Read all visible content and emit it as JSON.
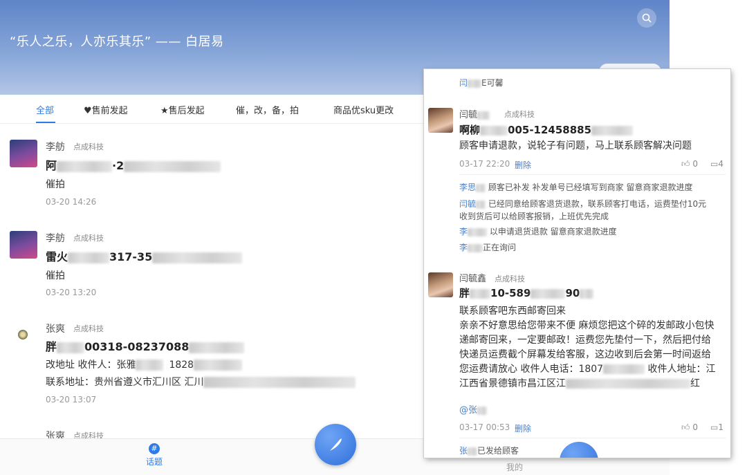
{
  "banner": {
    "quote": "“乐人之乐，人亦乐其乐” —— 白居易"
  },
  "tabs": [
    "全部",
    "♥售前发起",
    "★售后发起",
    "催，改，备，拍",
    "商品优sku更改"
  ],
  "posts": [
    {
      "user": "李舫",
      "corp": "点成科技",
      "title_pre": "阿",
      "title_mid": "·2",
      "body": [
        "催拍"
      ],
      "time": "03-20 14:26"
    },
    {
      "user": "李舫",
      "corp": "点成科技",
      "title_pre": "雷火",
      "title_mid": "317-35",
      "body": [
        "催拍"
      ],
      "time": "03-20 13:20"
    },
    {
      "user": "张爽",
      "corp": "点成科技",
      "title_pre": "胖",
      "title_mid": "00318-08237088",
      "body": [
        "改地址  收件人：张雅",
        "联系地址：贵州省遵义市汇川区 汇川"
      ],
      "body_extra": "1828",
      "time": "03-20 13:07"
    },
    {
      "user": "张爽",
      "corp": "点成科技"
    }
  ],
  "bottom_nav": {
    "topic_icon": "#",
    "topic_label": "话题",
    "mine_label": "我的"
  },
  "popup": {
    "top_line": {
      "name": "闫",
      "text": "E可馨"
    },
    "thread1": {
      "user": "闫毓",
      "corp": "点成科技",
      "title_pre": "啊柳",
      "title_mid": "005-12458885",
      "body": "顾客申请退款，说轮子有问题，马上联系顾客解决问题",
      "time": "03-17 22:20",
      "delete": "删除",
      "likes": "0",
      "comments": "4",
      "replies": [
        {
          "name": "李思",
          "text": "顾客已补发 补发单号已经填写到商家 留意商家退款进度"
        },
        {
          "name": "闫毓",
          "text": "已经同意给顾客退货退款，联系顾客打电话，运费垫付10元"
        },
        {
          "name": "",
          "text": "收到货后可以给顾客报销，上班优先完成"
        },
        {
          "name": "李",
          "text": "以申请退货退款 留意商家退款进度"
        },
        {
          "name": "李",
          "text": "正在询问"
        }
      ]
    },
    "thread2": {
      "user": "闫毓鑫",
      "corp": "点成科技",
      "title_pre": "胖",
      "title_mid": "10-589",
      "title_end": "90",
      "body_lines": [
        "联系顾客吧东西邮寄回来",
        "亲亲不好意思给您带来不便 麻烦您把这个碎的发邮政小包快",
        "递邮寄回来，一定要邮政！运费您先垫付一下，然后把付给",
        "快递员运费截个屏幕发给客服，这边收到后会第一时间返给",
        "您运费请放心 收件人电话：1807",
        "江西省景德镇市昌江区江"
      ],
      "line5_tail": "收件人地址：江",
      "line6_tail": "红",
      "mention": "@张",
      "time": "03-17 00:53",
      "delete": "删除",
      "likes": "0",
      "comments": "1",
      "reply": {
        "name": "张",
        "text": "已发给顾客"
      }
    }
  }
}
